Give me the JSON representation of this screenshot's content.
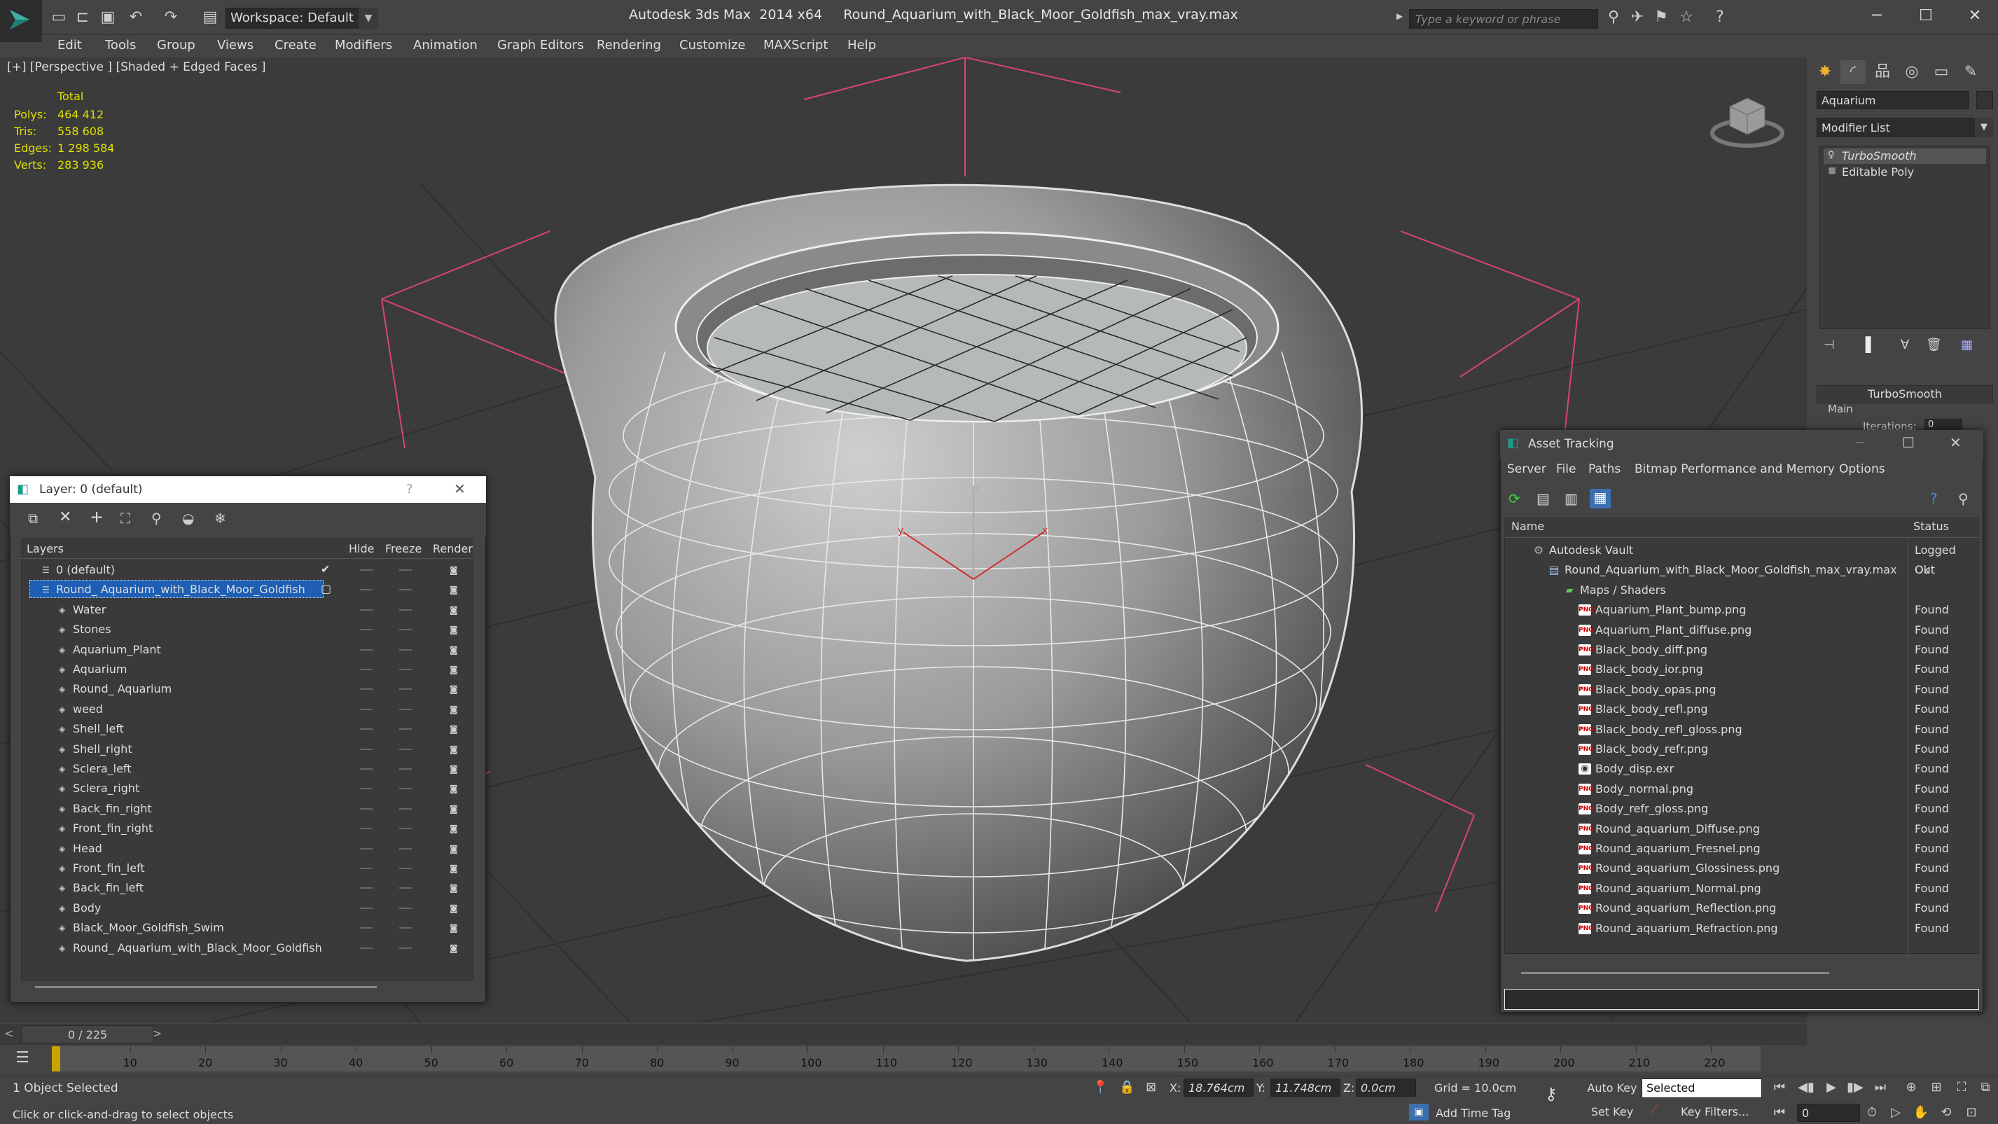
{
  "app": {
    "title": "Autodesk 3ds Max  2014 x64     Round_Aquarium_with_Black_Moor_Goldfish_max_vray.max",
    "workspace": "Workspace: Default",
    "search_placeholder": "Type a keyword or phrase"
  },
  "menu": [
    "Edit",
    "Tools",
    "Group",
    "Views",
    "Create",
    "Modifiers",
    "Animation",
    "Graph Editors",
    "Rendering",
    "Customize",
    "MAXScript",
    "Help"
  ],
  "viewport": {
    "label": "[+] [Perspective ] [Shaded + Edged Faces ]",
    "stats_title": "Total",
    "stats": [
      {
        "key": "Polys:",
        "value": "464 412"
      },
      {
        "key": "Tris:",
        "value": "558 608"
      },
      {
        "key": "Edges:",
        "value": "1 298 584"
      },
      {
        "key": "Verts:",
        "value": "283 936"
      }
    ],
    "axis_labels": {
      "x": "x",
      "y": "y",
      "z": "z"
    }
  },
  "command_panel": {
    "object_name": "Aquarium",
    "modifier_list": "Modifier List",
    "stack": [
      "TurboSmooth",
      "Editable Poly"
    ],
    "rollout_title": "TurboSmooth",
    "rollout_section": "Main",
    "iterations_label": "Iterations:",
    "iterations_value": "0"
  },
  "layer_dialog": {
    "title": "Layer: 0 (default)",
    "help": "?",
    "columns": {
      "layers": "Layers",
      "hide": "Hide",
      "freeze": "Freeze",
      "render": "Render"
    },
    "rows": [
      {
        "name": "0 (default)",
        "level": 0
      },
      {
        "name": "Round_ Aquarium_with_Black_Moor_Goldfish",
        "level": 0,
        "selected": true
      },
      {
        "name": "Water",
        "level": 1
      },
      {
        "name": "Stones",
        "level": 1
      },
      {
        "name": "Aquarium_Plant",
        "level": 1
      },
      {
        "name": "Aquarium",
        "level": 1
      },
      {
        "name": "Round_ Aquarium",
        "level": 1
      },
      {
        "name": "weed",
        "level": 1
      },
      {
        "name": "Shell_left",
        "level": 1
      },
      {
        "name": "Shell_right",
        "level": 1
      },
      {
        "name": "Sclera_left",
        "level": 1
      },
      {
        "name": "Sclera_right",
        "level": 1
      },
      {
        "name": "Back_fin_right",
        "level": 1
      },
      {
        "name": "Front_fin_right",
        "level": 1
      },
      {
        "name": "Head",
        "level": 1
      },
      {
        "name": "Front_fin_left",
        "level": 1
      },
      {
        "name": "Back_fin_left",
        "level": 1
      },
      {
        "name": "Body",
        "level": 1
      },
      {
        "name": "Black_Moor_Goldfish_Swim",
        "level": 1
      },
      {
        "name": "Round_ Aquarium_with_Black_Moor_Goldfish",
        "level": 1
      }
    ]
  },
  "asset_dialog": {
    "title": "Asset Tracking",
    "menu": [
      "Server",
      "File",
      "Paths",
      "Bitmap Performance and Memory",
      "Options"
    ],
    "columns": {
      "name": "Name",
      "status": "Status"
    },
    "rows": [
      {
        "name": "Autodesk Vault",
        "status": "Logged Out",
        "level": 0,
        "icon": "vault"
      },
      {
        "name": "Round_Aquarium_with_Black_Moor_Goldfish_max_vray.max",
        "status": "Ok",
        "level": 1,
        "icon": "max"
      },
      {
        "name": "Maps / Shaders",
        "status": "",
        "level": 2,
        "icon": "folder"
      },
      {
        "name": "Aquarium_Plant_bump.png",
        "status": "Found",
        "level": 3,
        "icon": "png"
      },
      {
        "name": "Aquarium_Plant_diffuse.png",
        "status": "Found",
        "level": 3,
        "icon": "png"
      },
      {
        "name": "Black_body_diff.png",
        "status": "Found",
        "level": 3,
        "icon": "png"
      },
      {
        "name": "Black_body_ior.png",
        "status": "Found",
        "level": 3,
        "icon": "png"
      },
      {
        "name": "Black_body_opas.png",
        "status": "Found",
        "level": 3,
        "icon": "png"
      },
      {
        "name": "Black_body_refl.png",
        "status": "Found",
        "level": 3,
        "icon": "png"
      },
      {
        "name": "Black_body_refl_gloss.png",
        "status": "Found",
        "level": 3,
        "icon": "png"
      },
      {
        "name": "Black_body_refr.png",
        "status": "Found",
        "level": 3,
        "icon": "png"
      },
      {
        "name": "Body_disp.exr",
        "status": "Found",
        "level": 3,
        "icon": "exr"
      },
      {
        "name": "Body_normal.png",
        "status": "Found",
        "level": 3,
        "icon": "png"
      },
      {
        "name": "Body_refr_gloss.png",
        "status": "Found",
        "level": 3,
        "icon": "png"
      },
      {
        "name": "Round_aquarium_Diffuse.png",
        "status": "Found",
        "level": 3,
        "icon": "png"
      },
      {
        "name": "Round_aquarium_Fresnel.png",
        "status": "Found",
        "level": 3,
        "icon": "png"
      },
      {
        "name": "Round_aquarium_Glossiness.png",
        "status": "Found",
        "level": 3,
        "icon": "png"
      },
      {
        "name": "Round_aquarium_Normal.png",
        "status": "Found",
        "level": 3,
        "icon": "png"
      },
      {
        "name": "Round_aquarium_Reflection.png",
        "status": "Found",
        "level": 3,
        "icon": "png"
      },
      {
        "name": "Round_aquarium_Refraction.png",
        "status": "Found",
        "level": 3,
        "icon": "png"
      }
    ]
  },
  "timeline": {
    "slider": "0 / 225",
    "ticks": [
      "10",
      "20",
      "30",
      "40",
      "50",
      "60",
      "70",
      "80",
      "90",
      "100",
      "110",
      "120",
      "130",
      "140",
      "150",
      "160",
      "170",
      "180",
      "190",
      "200",
      "210",
      "220"
    ]
  },
  "status": {
    "selection": "1 Object Selected",
    "prompt": "Click or click-and-drag to select objects",
    "x_label": "X:",
    "x_value": "18.764cm",
    "y_label": "Y:",
    "y_value": "11.748cm",
    "z_label": "Z:",
    "z_value": "0.0cm",
    "grid": "Grid = 10.0cm",
    "auto_key": "Auto Key",
    "set_key": "Set Key",
    "selected_mode": "Selected",
    "key_filters": "Key Filters...",
    "add_time_tag": "Add Time Tag",
    "frame": "0"
  },
  "colors": {
    "accent_selection": "#1e5fb4",
    "stats_text": "#e0e000",
    "gizmo_pink": "#d8466e",
    "time_marker": "#c9a400"
  }
}
